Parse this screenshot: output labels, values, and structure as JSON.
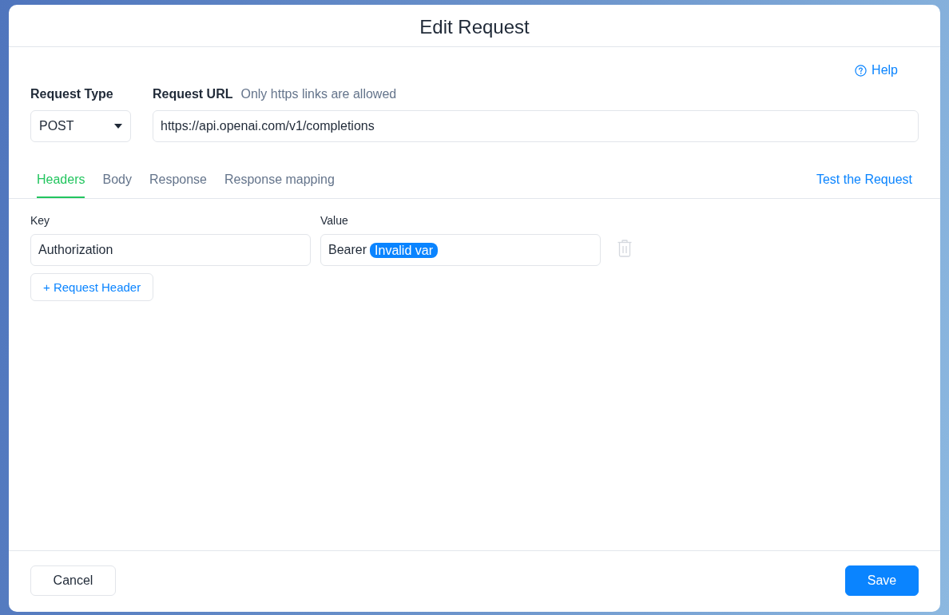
{
  "dialog": {
    "title": "Edit Request",
    "help_link": "Help"
  },
  "request_type": {
    "label": "Request Type",
    "value": "POST"
  },
  "request_url": {
    "label": "Request URL",
    "hint": "Only https links are allowed",
    "value": "https://api.openai.com/v1/completions"
  },
  "tabs": [
    {
      "label": "Headers",
      "selected": true
    },
    {
      "label": "Body",
      "selected": false
    },
    {
      "label": "Response",
      "selected": false
    },
    {
      "label": "Response mapping",
      "selected": false
    }
  ],
  "test_link": "Test the Request",
  "headers": {
    "key_label": "Key",
    "value_label": "Value",
    "rows": [
      {
        "key": "Authorization",
        "value_parts": [
          {
            "kind": "text",
            "text": "Bearer"
          },
          {
            "kind": "variable",
            "text": "Invalid var"
          }
        ]
      }
    ],
    "add_button": "+ Request Header"
  },
  "footer": {
    "cancel": "Cancel",
    "save": "Save"
  }
}
